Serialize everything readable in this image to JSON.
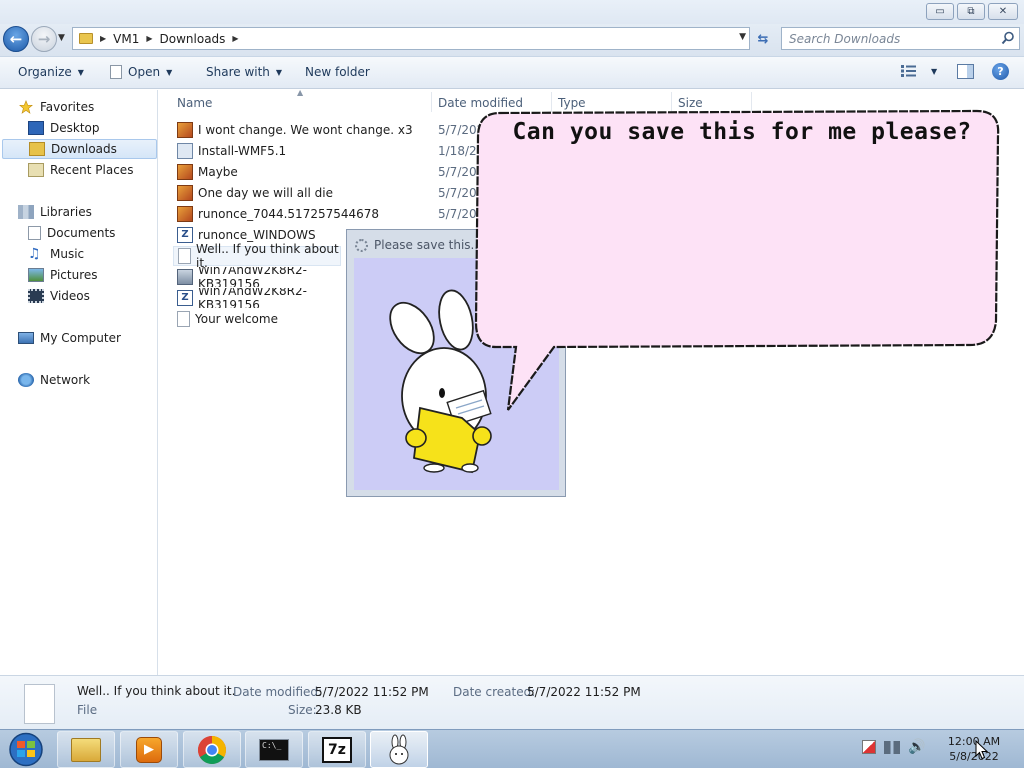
{
  "window": {
    "minimize": "▭",
    "maximize": "⧉",
    "close": "✕"
  },
  "address": {
    "crumbs": [
      "VM1",
      "Downloads"
    ],
    "search_placeholder": "Search Downloads"
  },
  "toolbar": {
    "organize": "Organize",
    "open": "Open",
    "share_with": "Share with",
    "new_folder": "New folder",
    "help": "?"
  },
  "nav": {
    "favorites": "Favorites",
    "desktop": "Desktop",
    "downloads": "Downloads",
    "recent_places": "Recent Places",
    "libraries": "Libraries",
    "documents": "Documents",
    "music": "Music",
    "pictures": "Pictures",
    "videos": "Videos",
    "my_computer": "My Computer",
    "network": "Network"
  },
  "columns": {
    "name": "Name",
    "date_modified": "Date modified",
    "type": "Type",
    "size": "Size"
  },
  "files": [
    {
      "name": "I wont change. We wont change. x3",
      "date": "5/7/2022",
      "icon": "media-file-icon"
    },
    {
      "name": "Install-WMF5.1",
      "date": "1/18/2",
      "icon": "powershell-file-icon"
    },
    {
      "name": "Maybe",
      "date": "5/7/20",
      "icon": "media-file-icon"
    },
    {
      "name": "One day we will all die",
      "date": "5/7/20",
      "icon": "media-file-icon"
    },
    {
      "name": "runonce_7044.517257544678",
      "date": "5/7/20",
      "icon": "media-file-icon"
    },
    {
      "name": "runonce_WINDOWS",
      "date": "",
      "icon": "archive-file-icon"
    },
    {
      "name": "Well.. If you think about it.",
      "date": "",
      "icon": "blank-file-icon"
    },
    {
      "name": "Win7AndW2K8R2-KB319156",
      "date": "",
      "icon": "installer-file-icon"
    },
    {
      "name": "Win7AndW2K8R2-KB319156",
      "date": "",
      "icon": "archive-file-icon"
    },
    {
      "name": "Your welcome",
      "date": "",
      "icon": "blank-file-icon"
    }
  ],
  "details": {
    "name": "Well.. If you think about it.",
    "type": "File",
    "date_modified_label": "Date modified:",
    "date_modified": "5/7/2022 11:52 PM",
    "date_created_label": "Date created:",
    "date_created": "5/7/2022 11:52 PM",
    "size_label": "Size:",
    "size": "23.8 KB"
  },
  "popup": {
    "title": "Please save this..."
  },
  "bubble": {
    "text": "Can you save this for me please?"
  },
  "clock": {
    "time": "12:00 AM",
    "date": "5/8/2022"
  },
  "colors": {
    "bubble_fill": "#fde2f6",
    "popup_background": "#ccccf6",
    "folder_yellow": "#f6e21a"
  }
}
